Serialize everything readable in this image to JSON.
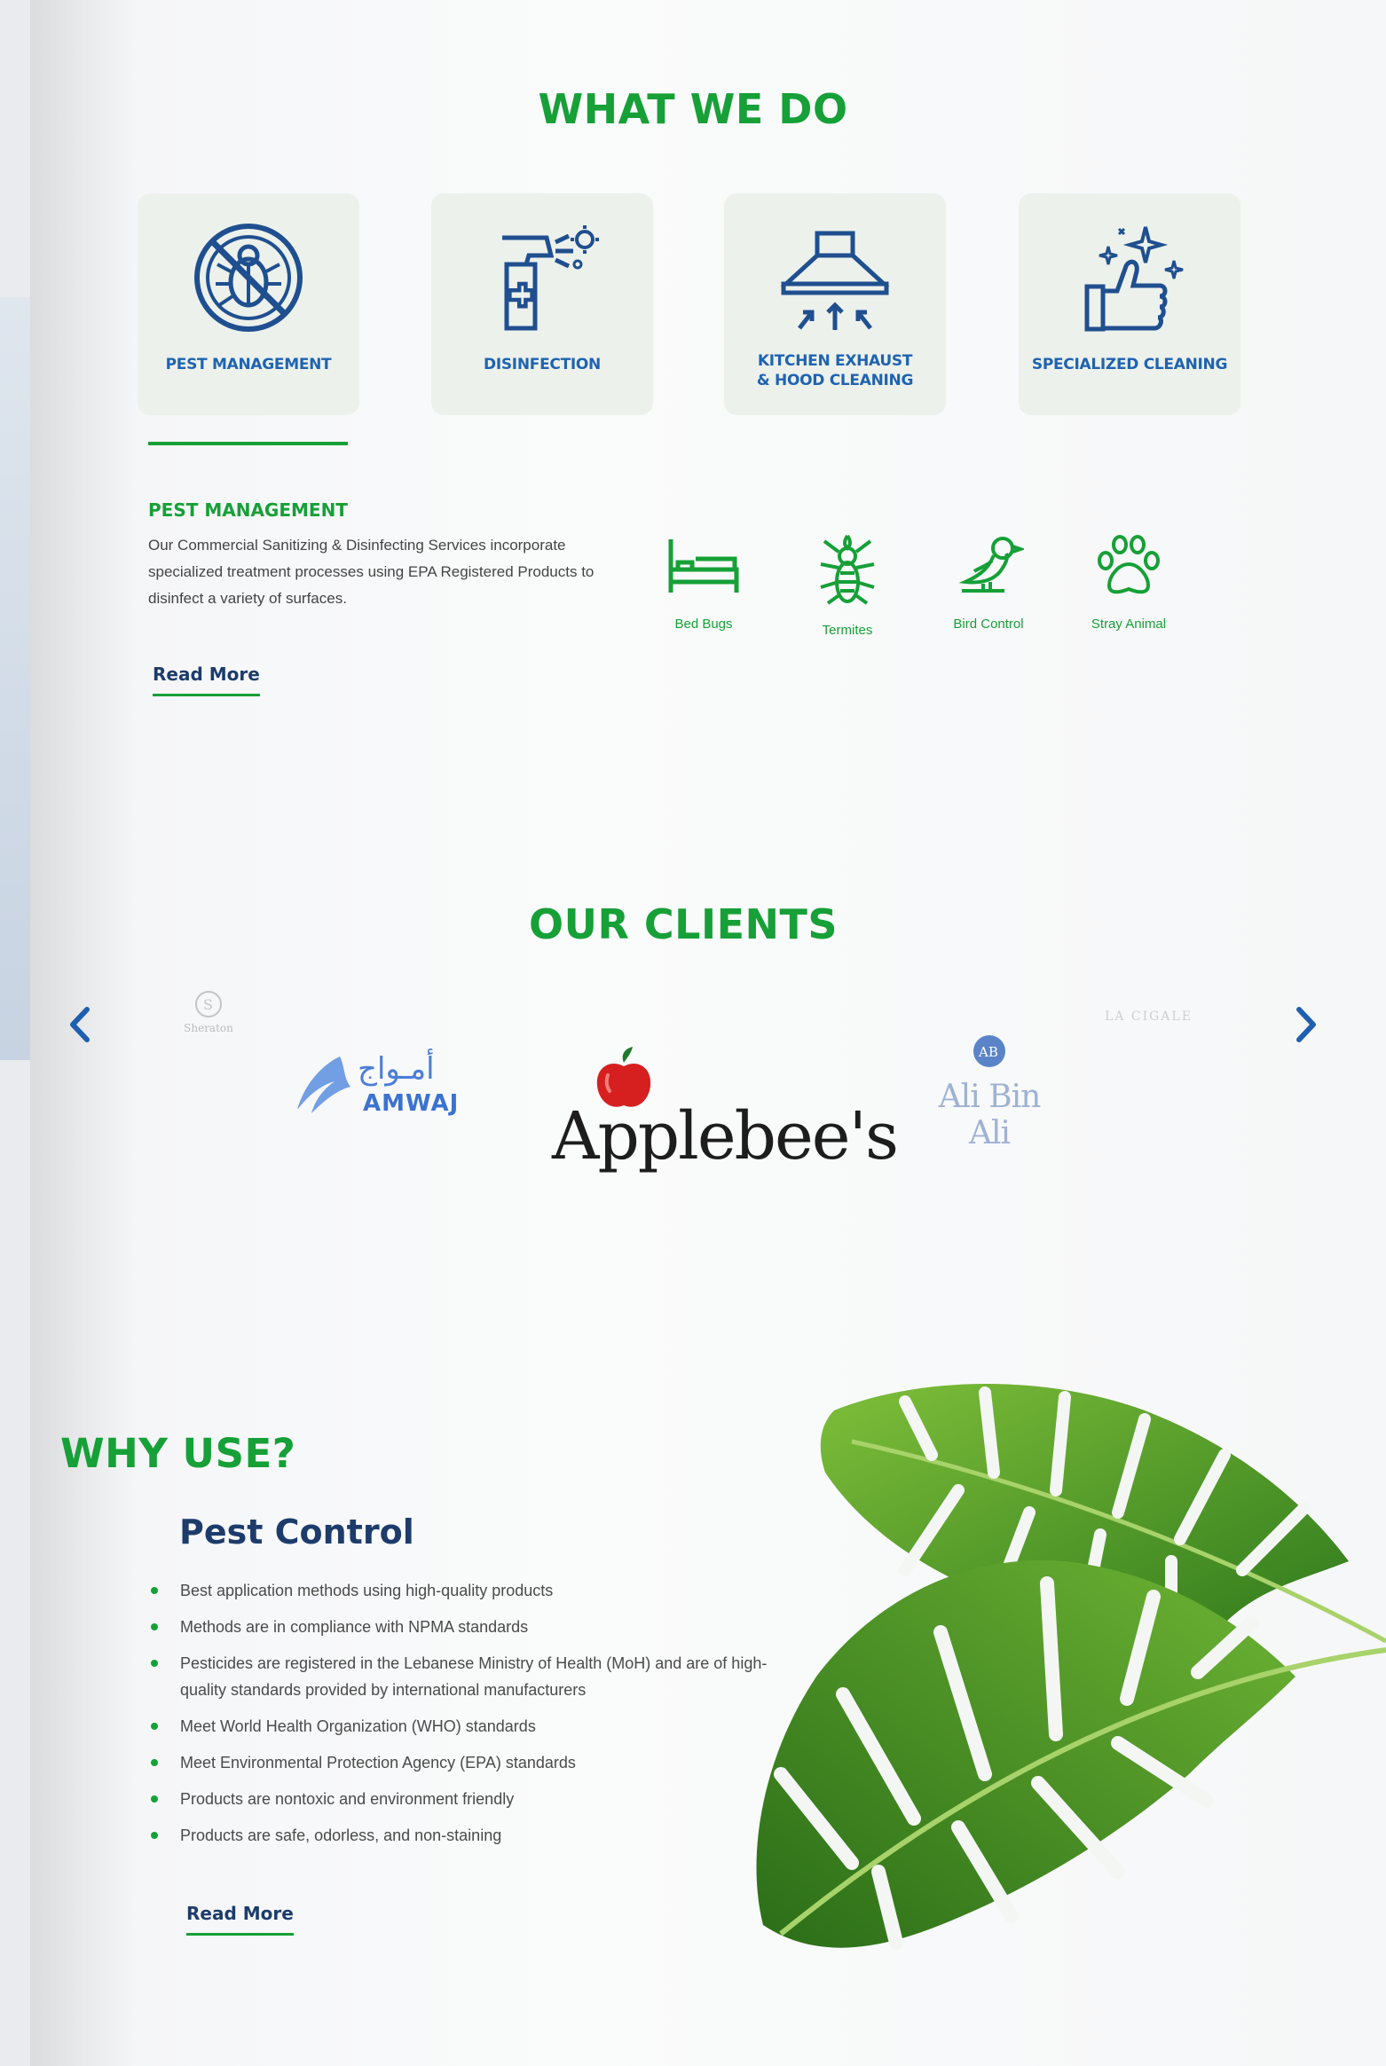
{
  "what_we_do": {
    "heading": "WHAT WE DO",
    "services": [
      {
        "label": "PEST MANAGEMENT",
        "icon": "no-bug-icon"
      },
      {
        "label": "DISINFECTION",
        "icon": "spray-bottle-icon"
      },
      {
        "label_line1": "KITCHEN EXHAUST",
        "label_line2": "& HOOD CLEANING",
        "icon": "exhaust-hood-icon"
      },
      {
        "label": "SPECIALIZED CLEANING",
        "icon": "thumbs-up-sparkle-icon"
      }
    ],
    "active": {
      "title": "PEST MANAGEMENT",
      "description": "Our Commercial Sanitizing & Disinfecting Services incorporate specialized treatment processes using EPA Registered Products to disinfect a variety of surfaces.",
      "read_more": "Read More",
      "pests": [
        {
          "label": "Bed Bugs",
          "icon": "bed-icon"
        },
        {
          "label": "Termites",
          "icon": "termite-icon"
        },
        {
          "label": "Bird Control",
          "icon": "bird-icon"
        },
        {
          "label": "Stray Animal",
          "icon": "paw-icon"
        }
      ]
    }
  },
  "clients": {
    "heading": "OUR CLIENTS",
    "logos": {
      "sheraton": "Sheraton",
      "amwaj_ar": "أمـواج",
      "amwaj_en": "AMWAJ",
      "applebees": "Applebee's",
      "alibinali_mark": "AB",
      "alibinali": "Ali Bin Ali",
      "right_partial": "LA CIGALE"
    }
  },
  "why_use": {
    "heading": "WHY USE?",
    "subheading": "Pest Control",
    "points": [
      "Best application methods using high-quality products",
      "Methods are in compliance with NPMA standards",
      "Pesticides are registered in the Lebanese Ministry of Health (MoH) and are of high-quality standards provided by international manufacturers",
      "Meet World Health Organization (WHO) standards",
      "Meet Environmental Protection Agency (EPA) standards",
      "Products are nontoxic and environment friendly",
      "Products are safe, odorless, and non-staining"
    ],
    "read_more": "Read More"
  },
  "colors": {
    "brand_green": "#16a037",
    "brand_blue": "#1f63b0",
    "navy": "#1d3c6b"
  }
}
